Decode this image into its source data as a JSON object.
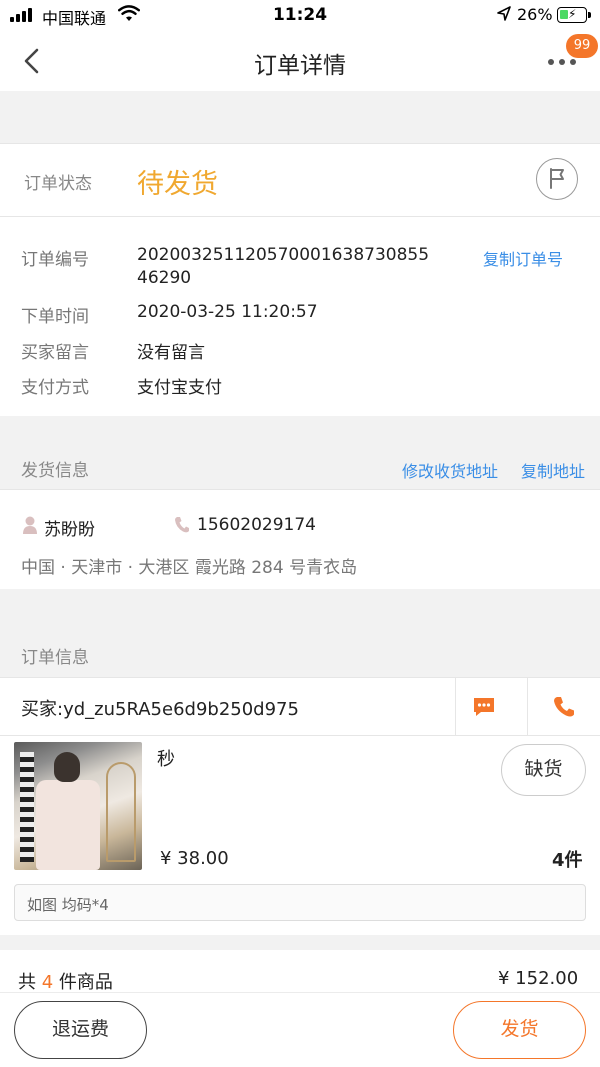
{
  "status_bar": {
    "carrier": "中国联通",
    "time": "11:24",
    "battery": "26%",
    "battery_level": 0.26
  },
  "nav": {
    "title": "订单详情",
    "badge": "99"
  },
  "order_status": {
    "label": "订单状态",
    "value": "待发货"
  },
  "order_details": {
    "number_label": "订单编号",
    "number_line1": "20200325112057000163873085​5",
    "number_line2": "46290",
    "copy_order": "复制订单号",
    "time_label": "下单时间",
    "time_value": "2020-03-25 11:20:57",
    "note_label": "买家留言",
    "note_value": "没有留言",
    "pay_label": "支付方式",
    "pay_value": "支付宝支付"
  },
  "shipping": {
    "title": "发货信息",
    "edit_address": "修改收货地址",
    "copy_address": "复制地址",
    "name": "苏盼盼",
    "phone": "15602029174",
    "address": "中国 · 天津市 · 大港区 霞光路 284 号青衣岛"
  },
  "order_info": {
    "title": "订单信息",
    "buyer": "买家:yd_zu5RA5e6d9b250d975",
    "product_name": "秒",
    "out_of_stock": "缺货",
    "price": "¥ 38.00",
    "qty": "4件",
    "spec": "如图 均码*4"
  },
  "summary": {
    "prefix": "共",
    "count": "4",
    "suffix": "件商品",
    "total": "¥ 152.00"
  },
  "bottom": {
    "refund_shipping": "退运费",
    "ship": "发货"
  },
  "colors": {
    "accent": "#f4762a",
    "status": "#f0a830",
    "link": "#3a8ee6"
  }
}
